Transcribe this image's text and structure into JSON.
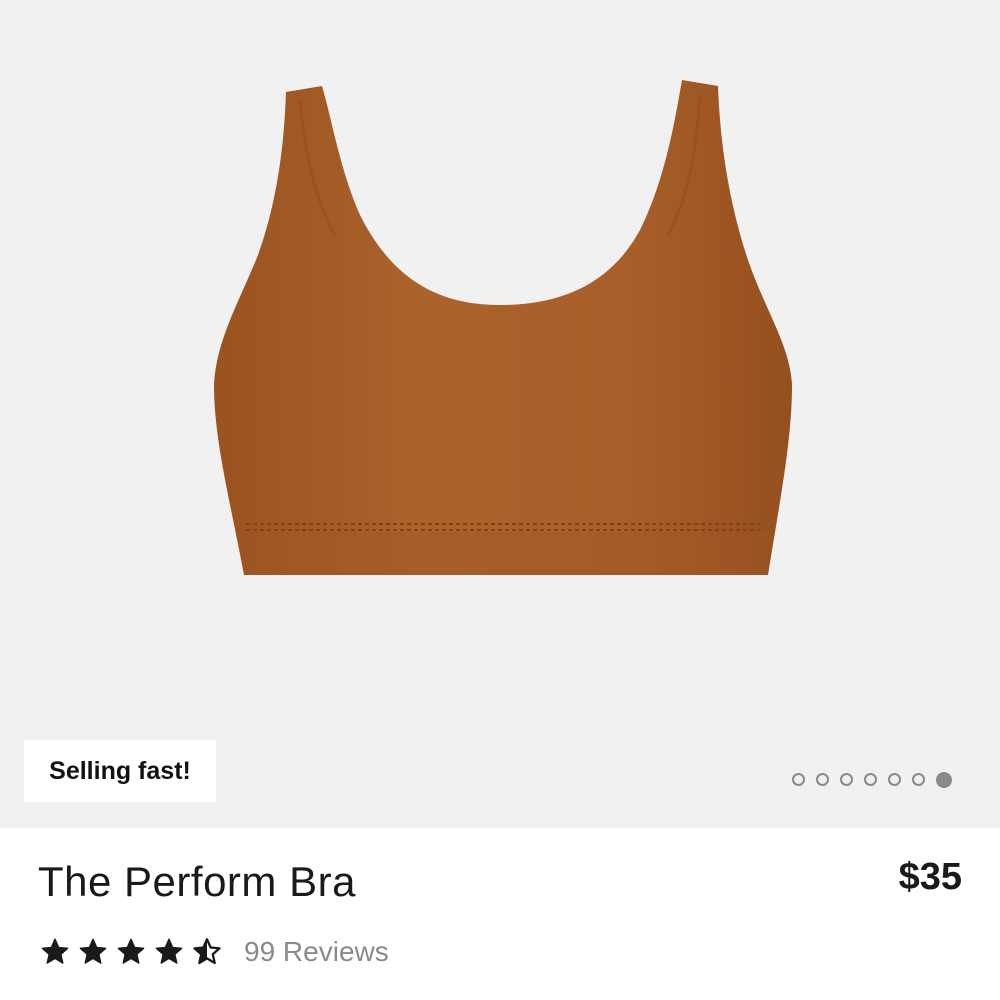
{
  "product": {
    "badge": "Selling fast!",
    "title": "The Perform Bra",
    "price": "$35",
    "rating": 4.5,
    "reviews_label": "99 Reviews",
    "color": "#a9602a"
  },
  "carousel": {
    "total_slides": 7,
    "active_index": 6
  },
  "icons": {
    "star": "star-icon",
    "half_star": "half-star-icon"
  }
}
